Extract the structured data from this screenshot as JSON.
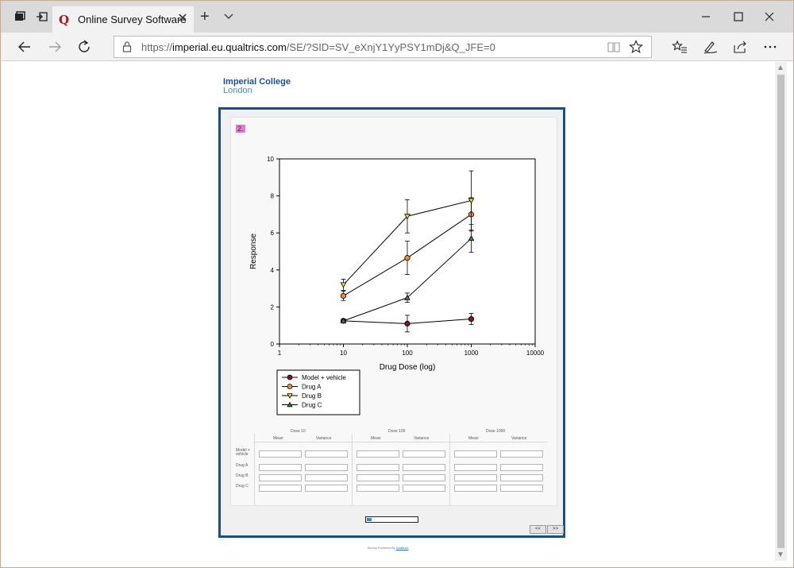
{
  "browser": {
    "tab_title": "Online Survey Software",
    "url_prefix": "https://",
    "url_host": "imperial.eu.qualtrics.com",
    "url_path": "/SE/?SID=SV_eXnjY1YyPSY1mDj&Q_JFE=0"
  },
  "page": {
    "logo_line1": "Imperial College",
    "logo_line2": "London",
    "question_number": "2.",
    "powered_by_prefix": "Survey Powered By ",
    "powered_by_link": "Qualtrics",
    "prev_button": "<<",
    "next_button": ">>",
    "progress_fraction": 0.1
  },
  "table": {
    "groups": [
      "Dose 10",
      "Dose 100",
      "Dose 1000"
    ],
    "subcols": [
      "Mean",
      "Variance"
    ],
    "rows": [
      "Model + vehicle",
      "Drug A",
      "Drug B",
      "Drug C"
    ]
  },
  "colors": {
    "frame_border": "#1a4e85",
    "question_tag": "#e27bd4",
    "model_vehicle": "#7a1a1a",
    "drug_a": "#f08c2a",
    "drug_b": "#e8e32a",
    "drug_c": "#2e8a3a"
  },
  "chart_data": {
    "type": "line",
    "xlabel": "Drug Dose (log)",
    "ylabel": "Response",
    "xscale": "log",
    "xlim": [
      1,
      10000
    ],
    "ylim": [
      0,
      10
    ],
    "x_ticks": [
      "1",
      "10",
      "100",
      "1000",
      "10000"
    ],
    "y_ticks": [
      "0",
      "2",
      "4",
      "6",
      "8",
      "10"
    ],
    "legend_position": "bottom-left",
    "series": [
      {
        "name": "Model + vehicle",
        "marker": "circle",
        "color": "#7a1a1a",
        "x": [
          10,
          100,
          1000
        ],
        "y": [
          1.25,
          1.1,
          1.35
        ],
        "err": [
          0.1,
          0.45,
          0.3
        ]
      },
      {
        "name": "Drug A",
        "marker": "circle",
        "color": "#f08c2a",
        "x": [
          10,
          100,
          1000
        ],
        "y": [
          2.6,
          4.65,
          7.0
        ],
        "err": [
          0.25,
          0.9,
          0.9
        ]
      },
      {
        "name": "Drug B",
        "marker": "triangle-down",
        "color": "#e8e32a",
        "x": [
          10,
          100,
          1000
        ],
        "y": [
          3.2,
          6.9,
          7.75
        ],
        "err": [
          0.3,
          0.9,
          1.6
        ]
      },
      {
        "name": "Drug C",
        "marker": "triangle-up",
        "color": "#2e8a3a",
        "x": [
          10,
          100,
          1000
        ],
        "y": [
          1.25,
          2.5,
          5.7
        ],
        "err": [
          0.1,
          0.25,
          0.75
        ]
      }
    ]
  }
}
